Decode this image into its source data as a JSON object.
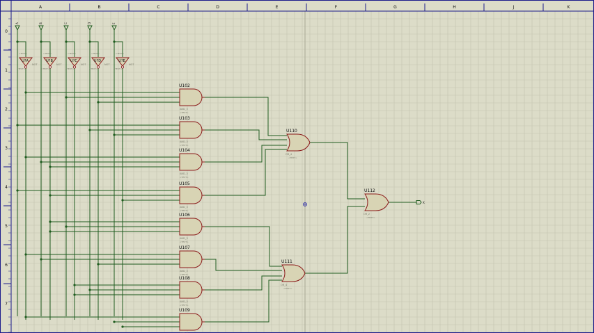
{
  "sheet": {
    "columns": [
      "A",
      "B",
      "C",
      "D",
      "E",
      "F",
      "G",
      "H",
      "J",
      "K"
    ],
    "rows": [
      "0",
      "1",
      "2",
      "3",
      "4",
      "5",
      "6",
      "7"
    ]
  },
  "colors": {
    "background": "#dcdcc8",
    "grid_minor": "#c2c2ae",
    "grid_major": "#a8a894",
    "border": "#1a1a8a",
    "wire": "#1f5c1f",
    "gate_outline": "#8b1a1a",
    "gate_fill": "#d8d4b4",
    "label": "#111111",
    "subtext": "#7a7a6a",
    "marker": "#2a2aa8"
  },
  "inputs": [
    "A",
    "B",
    "C",
    "D",
    "E"
  ],
  "inverters": [
    {
      "ref": "U?A",
      "part": "NOT"
    },
    {
      "ref": "U?B",
      "part": "NOT"
    },
    {
      "ref": "U?C",
      "part": "NOT"
    },
    {
      "ref": "U?D",
      "part": "NOT"
    },
    {
      "ref": "U?E",
      "part": "NOT"
    }
  ],
  "and_gates": [
    {
      "ref": "U102",
      "part": "AND_3"
    },
    {
      "ref": "U103",
      "part": "AND_3"
    },
    {
      "ref": "U104",
      "part": "AND_3"
    },
    {
      "ref": "U105",
      "part": "AND_3"
    },
    {
      "ref": "U106",
      "part": "AND_3"
    },
    {
      "ref": "U107",
      "part": "AND_3"
    },
    {
      "ref": "U108",
      "part": "AND_3"
    },
    {
      "ref": "U109",
      "part": "AND_3"
    }
  ],
  "or_gates": [
    {
      "ref": "U110",
      "part": "OR_4"
    },
    {
      "ref": "U111",
      "part": "OR_4"
    },
    {
      "ref": "U112",
      "part": "OR_2"
    }
  ],
  "text_tag": "<TEXT>",
  "output_label": "X"
}
